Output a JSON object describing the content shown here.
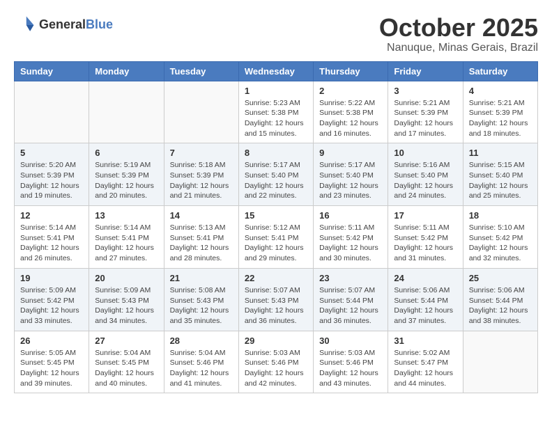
{
  "logo": {
    "general": "General",
    "blue": "Blue"
  },
  "header": {
    "month": "October 2025",
    "location": "Nanuque, Minas Gerais, Brazil"
  },
  "days_of_week": [
    "Sunday",
    "Monday",
    "Tuesday",
    "Wednesday",
    "Thursday",
    "Friday",
    "Saturday"
  ],
  "weeks": [
    {
      "shade": false,
      "days": [
        {
          "num": "",
          "info": ""
        },
        {
          "num": "",
          "info": ""
        },
        {
          "num": "",
          "info": ""
        },
        {
          "num": "1",
          "info": "Sunrise: 5:23 AM\nSunset: 5:38 PM\nDaylight: 12 hours and 15 minutes."
        },
        {
          "num": "2",
          "info": "Sunrise: 5:22 AM\nSunset: 5:38 PM\nDaylight: 12 hours and 16 minutes."
        },
        {
          "num": "3",
          "info": "Sunrise: 5:21 AM\nSunset: 5:39 PM\nDaylight: 12 hours and 17 minutes."
        },
        {
          "num": "4",
          "info": "Sunrise: 5:21 AM\nSunset: 5:39 PM\nDaylight: 12 hours and 18 minutes."
        }
      ]
    },
    {
      "shade": true,
      "days": [
        {
          "num": "5",
          "info": "Sunrise: 5:20 AM\nSunset: 5:39 PM\nDaylight: 12 hours and 19 minutes."
        },
        {
          "num": "6",
          "info": "Sunrise: 5:19 AM\nSunset: 5:39 PM\nDaylight: 12 hours and 20 minutes."
        },
        {
          "num": "7",
          "info": "Sunrise: 5:18 AM\nSunset: 5:39 PM\nDaylight: 12 hours and 21 minutes."
        },
        {
          "num": "8",
          "info": "Sunrise: 5:17 AM\nSunset: 5:40 PM\nDaylight: 12 hours and 22 minutes."
        },
        {
          "num": "9",
          "info": "Sunrise: 5:17 AM\nSunset: 5:40 PM\nDaylight: 12 hours and 23 minutes."
        },
        {
          "num": "10",
          "info": "Sunrise: 5:16 AM\nSunset: 5:40 PM\nDaylight: 12 hours and 24 minutes."
        },
        {
          "num": "11",
          "info": "Sunrise: 5:15 AM\nSunset: 5:40 PM\nDaylight: 12 hours and 25 minutes."
        }
      ]
    },
    {
      "shade": false,
      "days": [
        {
          "num": "12",
          "info": "Sunrise: 5:14 AM\nSunset: 5:41 PM\nDaylight: 12 hours and 26 minutes."
        },
        {
          "num": "13",
          "info": "Sunrise: 5:14 AM\nSunset: 5:41 PM\nDaylight: 12 hours and 27 minutes."
        },
        {
          "num": "14",
          "info": "Sunrise: 5:13 AM\nSunset: 5:41 PM\nDaylight: 12 hours and 28 minutes."
        },
        {
          "num": "15",
          "info": "Sunrise: 5:12 AM\nSunset: 5:41 PM\nDaylight: 12 hours and 29 minutes."
        },
        {
          "num": "16",
          "info": "Sunrise: 5:11 AM\nSunset: 5:42 PM\nDaylight: 12 hours and 30 minutes."
        },
        {
          "num": "17",
          "info": "Sunrise: 5:11 AM\nSunset: 5:42 PM\nDaylight: 12 hours and 31 minutes."
        },
        {
          "num": "18",
          "info": "Sunrise: 5:10 AM\nSunset: 5:42 PM\nDaylight: 12 hours and 32 minutes."
        }
      ]
    },
    {
      "shade": true,
      "days": [
        {
          "num": "19",
          "info": "Sunrise: 5:09 AM\nSunset: 5:42 PM\nDaylight: 12 hours and 33 minutes."
        },
        {
          "num": "20",
          "info": "Sunrise: 5:09 AM\nSunset: 5:43 PM\nDaylight: 12 hours and 34 minutes."
        },
        {
          "num": "21",
          "info": "Sunrise: 5:08 AM\nSunset: 5:43 PM\nDaylight: 12 hours and 35 minutes."
        },
        {
          "num": "22",
          "info": "Sunrise: 5:07 AM\nSunset: 5:43 PM\nDaylight: 12 hours and 36 minutes."
        },
        {
          "num": "23",
          "info": "Sunrise: 5:07 AM\nSunset: 5:44 PM\nDaylight: 12 hours and 36 minutes."
        },
        {
          "num": "24",
          "info": "Sunrise: 5:06 AM\nSunset: 5:44 PM\nDaylight: 12 hours and 37 minutes."
        },
        {
          "num": "25",
          "info": "Sunrise: 5:06 AM\nSunset: 5:44 PM\nDaylight: 12 hours and 38 minutes."
        }
      ]
    },
    {
      "shade": false,
      "days": [
        {
          "num": "26",
          "info": "Sunrise: 5:05 AM\nSunset: 5:45 PM\nDaylight: 12 hours and 39 minutes."
        },
        {
          "num": "27",
          "info": "Sunrise: 5:04 AM\nSunset: 5:45 PM\nDaylight: 12 hours and 40 minutes."
        },
        {
          "num": "28",
          "info": "Sunrise: 5:04 AM\nSunset: 5:46 PM\nDaylight: 12 hours and 41 minutes."
        },
        {
          "num": "29",
          "info": "Sunrise: 5:03 AM\nSunset: 5:46 PM\nDaylight: 12 hours and 42 minutes."
        },
        {
          "num": "30",
          "info": "Sunrise: 5:03 AM\nSunset: 5:46 PM\nDaylight: 12 hours and 43 minutes."
        },
        {
          "num": "31",
          "info": "Sunrise: 5:02 AM\nSunset: 5:47 PM\nDaylight: 12 hours and 44 minutes."
        },
        {
          "num": "",
          "info": ""
        }
      ]
    }
  ]
}
